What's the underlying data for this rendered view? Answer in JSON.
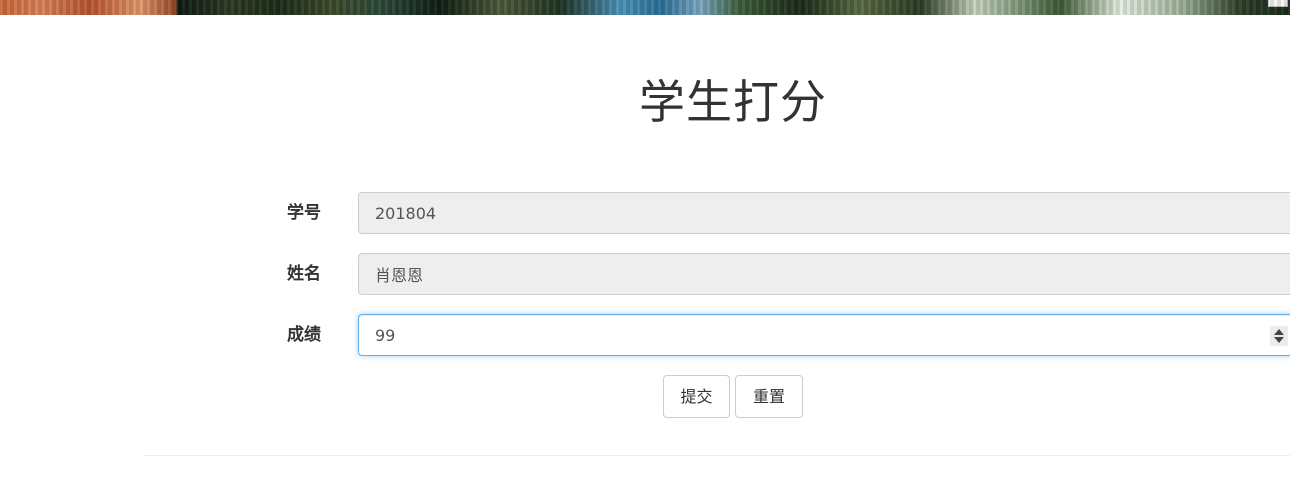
{
  "page": {
    "title": "学生打分"
  },
  "form": {
    "student_id": {
      "label": "学号",
      "value": "201804"
    },
    "name": {
      "label": "姓名",
      "value": "肖恩恩"
    },
    "score": {
      "label": "成绩",
      "value": "99"
    }
  },
  "buttons": {
    "submit_label": "提交",
    "reset_label": "重置"
  },
  "icons": {
    "spinner": "number-spinner-icon"
  },
  "colors": {
    "focus_border": "#66afe9",
    "readonly_bg": "#eeeeee",
    "text": "#333333"
  }
}
